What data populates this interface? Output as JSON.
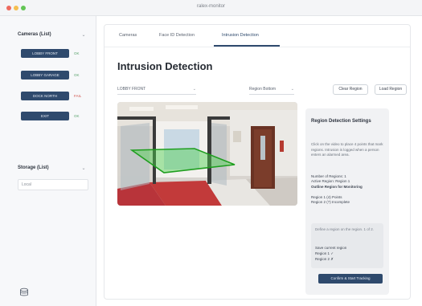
{
  "window": {
    "title": "ralex-monitor"
  },
  "sidebar": {
    "cameras": {
      "title": "Cameras (List)",
      "items": [
        {
          "label": "LOBBY FRONT",
          "status": "OK",
          "status_color": "#5aa36c"
        },
        {
          "label": "LOBBY GARAGE",
          "status": "OK",
          "status_color": "#5aa36c"
        },
        {
          "label": "DOCK NORTH",
          "status": "FAIL",
          "status_color": "#d0524a"
        },
        {
          "label": "EXIT",
          "status": "OK",
          "status_color": "#5aa36c"
        }
      ]
    },
    "database": {
      "title": "Storage (List)",
      "input_value": "Local"
    }
  },
  "tabs": [
    {
      "label": "Cameras",
      "active": false
    },
    {
      "label": "Face ID Detection",
      "active": false
    },
    {
      "label": "Intrusion Detection",
      "active": true
    }
  ],
  "page": {
    "title": "Intrusion Detection"
  },
  "toolbar": {
    "camera_select": "LOBBY FRONT",
    "region_select": "Region Bottom",
    "clear_label": "Clear Region",
    "load_label": "Load Region"
  },
  "panel": {
    "title": "Region Detection Settings",
    "description": "Click on the video to place 4 points that mark regions. Intrusion is logged when a person enters an alarmed area.",
    "stats": [
      {
        "label": "Number of Regions:",
        "value": "1"
      },
      {
        "label": "Active Region:",
        "value": "Region 1"
      }
    ],
    "outline_heading": "Outline Region for Monitoring",
    "region_status": [
      "Region 1 (4) Points",
      "Region 2 (?) Incomplete"
    ],
    "note": "Define a region on the region. 1 of 2.",
    "selected_label": "Save current region",
    "selected_values": [
      "Region 1 ✓",
      "Region 2 ✗"
    ],
    "apply_label": "Confirm & Start Tracking"
  },
  "video": {
    "region_color": "#4bd14b"
  }
}
